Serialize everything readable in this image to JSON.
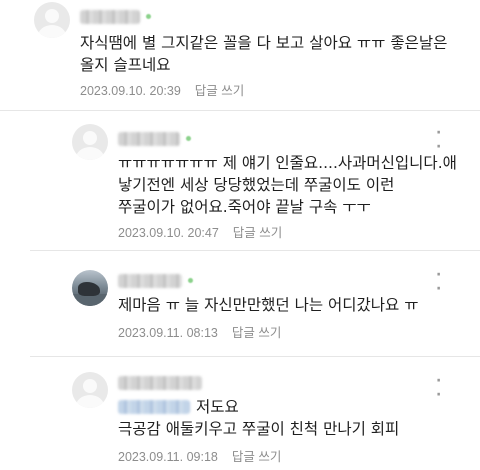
{
  "comments": [
    {
      "text": "자식땜에 별 그지같은 꼴을 다 보고 살아요 ㅠㅠ 좋은날은\n올지 슬프네요",
      "date": "2023.09.10. 20:39",
      "reply_label": "답글 쓰기",
      "avatar": "user-placeholder-icon"
    },
    {
      "text": "ㅠㅠㅠㅠㅠㅠㅠ 제 얘기 인줄요....사과머신입니다.애\n낳기전엔 세상 당당했었는데 쭈굴이도 이런\n쭈굴이가 없어요.죽어야 끝날 구속 ㅜㅜ",
      "date": "2023.09.10. 20:47",
      "reply_label": "답글 쓰기",
      "avatar": "user-placeholder-icon"
    },
    {
      "text": "제마음 ㅠ 늘 자신만만했던 나는 어디갔나요 ㅠ",
      "date": "2023.09.11. 08:13",
      "reply_label": "답글 쓰기",
      "avatar": "profile-photo"
    },
    {
      "mention": "저도요",
      "text": "극공감 애둘키우고 쭈굴이 친척 만나기 회피",
      "date": "2023.09.11. 09:18",
      "reply_label": "답글 쓰기",
      "avatar": "user-placeholder-icon"
    }
  ],
  "more_menu_icon": "more-dots-icon"
}
